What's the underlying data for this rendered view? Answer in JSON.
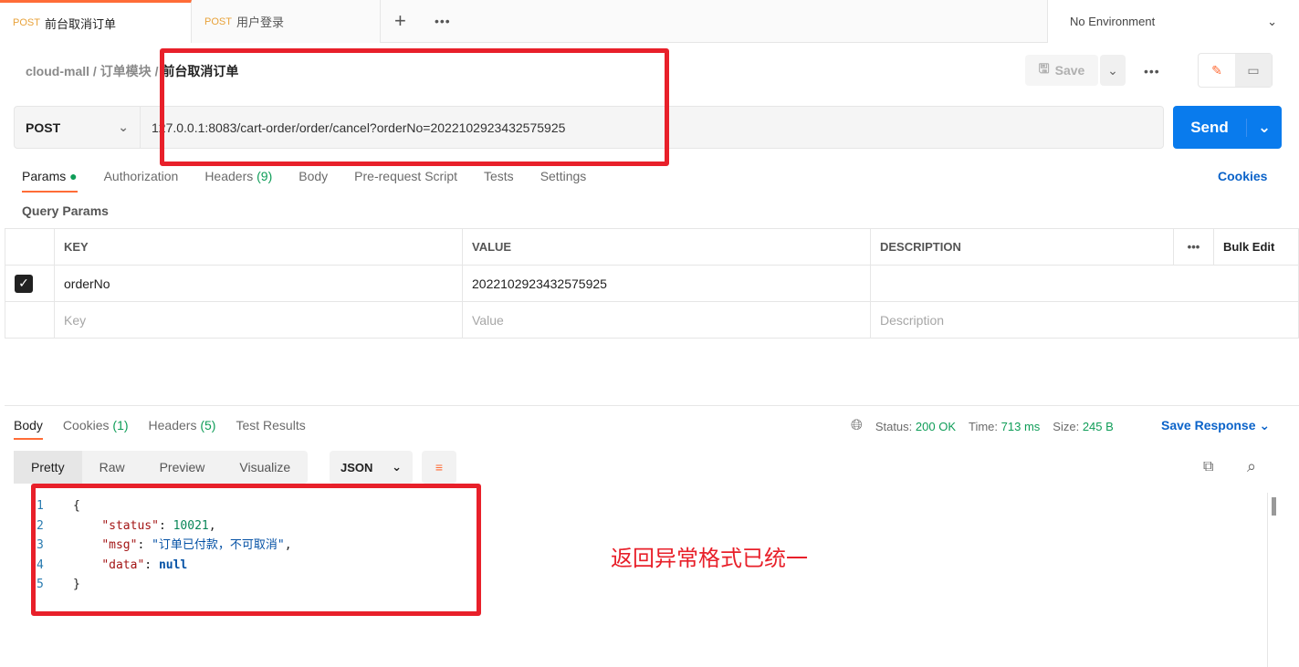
{
  "tabs": [
    {
      "method": "POST",
      "name": "前台取消订单"
    },
    {
      "method": "POST",
      "name": "用户登录"
    }
  ],
  "environment": "No Environment",
  "breadcrumb": {
    "collection": "cloud-mall",
    "folder": "订单模块",
    "request": "前台取消订单"
  },
  "save_label": "Save",
  "request": {
    "method": "POST",
    "url": "127.0.0.1:8083/cart-order/order/cancel?orderNo=2022102923432575925",
    "send": "Send"
  },
  "req_tabs": [
    "Params",
    "Authorization",
    "Headers",
    "(9)",
    "Body",
    "Pre-request Script",
    "Tests",
    "Settings"
  ],
  "cookies": "Cookies",
  "query_params": "Query Params",
  "table": {
    "headers": [
      "KEY",
      "VALUE",
      "DESCRIPTION"
    ],
    "bulk_edit": "Bulk Edit",
    "row": {
      "key": "orderNo",
      "value": "2022102923432575925"
    },
    "placeholder": {
      "key": "Key",
      "value": "Value",
      "description": "Description"
    }
  },
  "res_tabs": [
    "Body",
    "Cookies",
    "(1)",
    "Headers",
    "(5)",
    "Test Results"
  ],
  "status": {
    "status_label": "Status:",
    "status": "200 OK",
    "time_label": "Time:",
    "time": "713 ms",
    "size_label": "Size:",
    "size": "245 B"
  },
  "save_response": "Save Response",
  "formats": [
    "Pretty",
    "Raw",
    "Preview",
    "Visualize"
  ],
  "language": "JSON",
  "code": {
    "l1": "{",
    "k2": "\"status\"",
    "v2": "10021",
    "k3": "\"msg\"",
    "v3": "\"订单已付款，不可取消\"",
    "k4": "\"data\"",
    "v4": "null",
    "l5": "}"
  },
  "annotation": "返回异常格式已统一"
}
